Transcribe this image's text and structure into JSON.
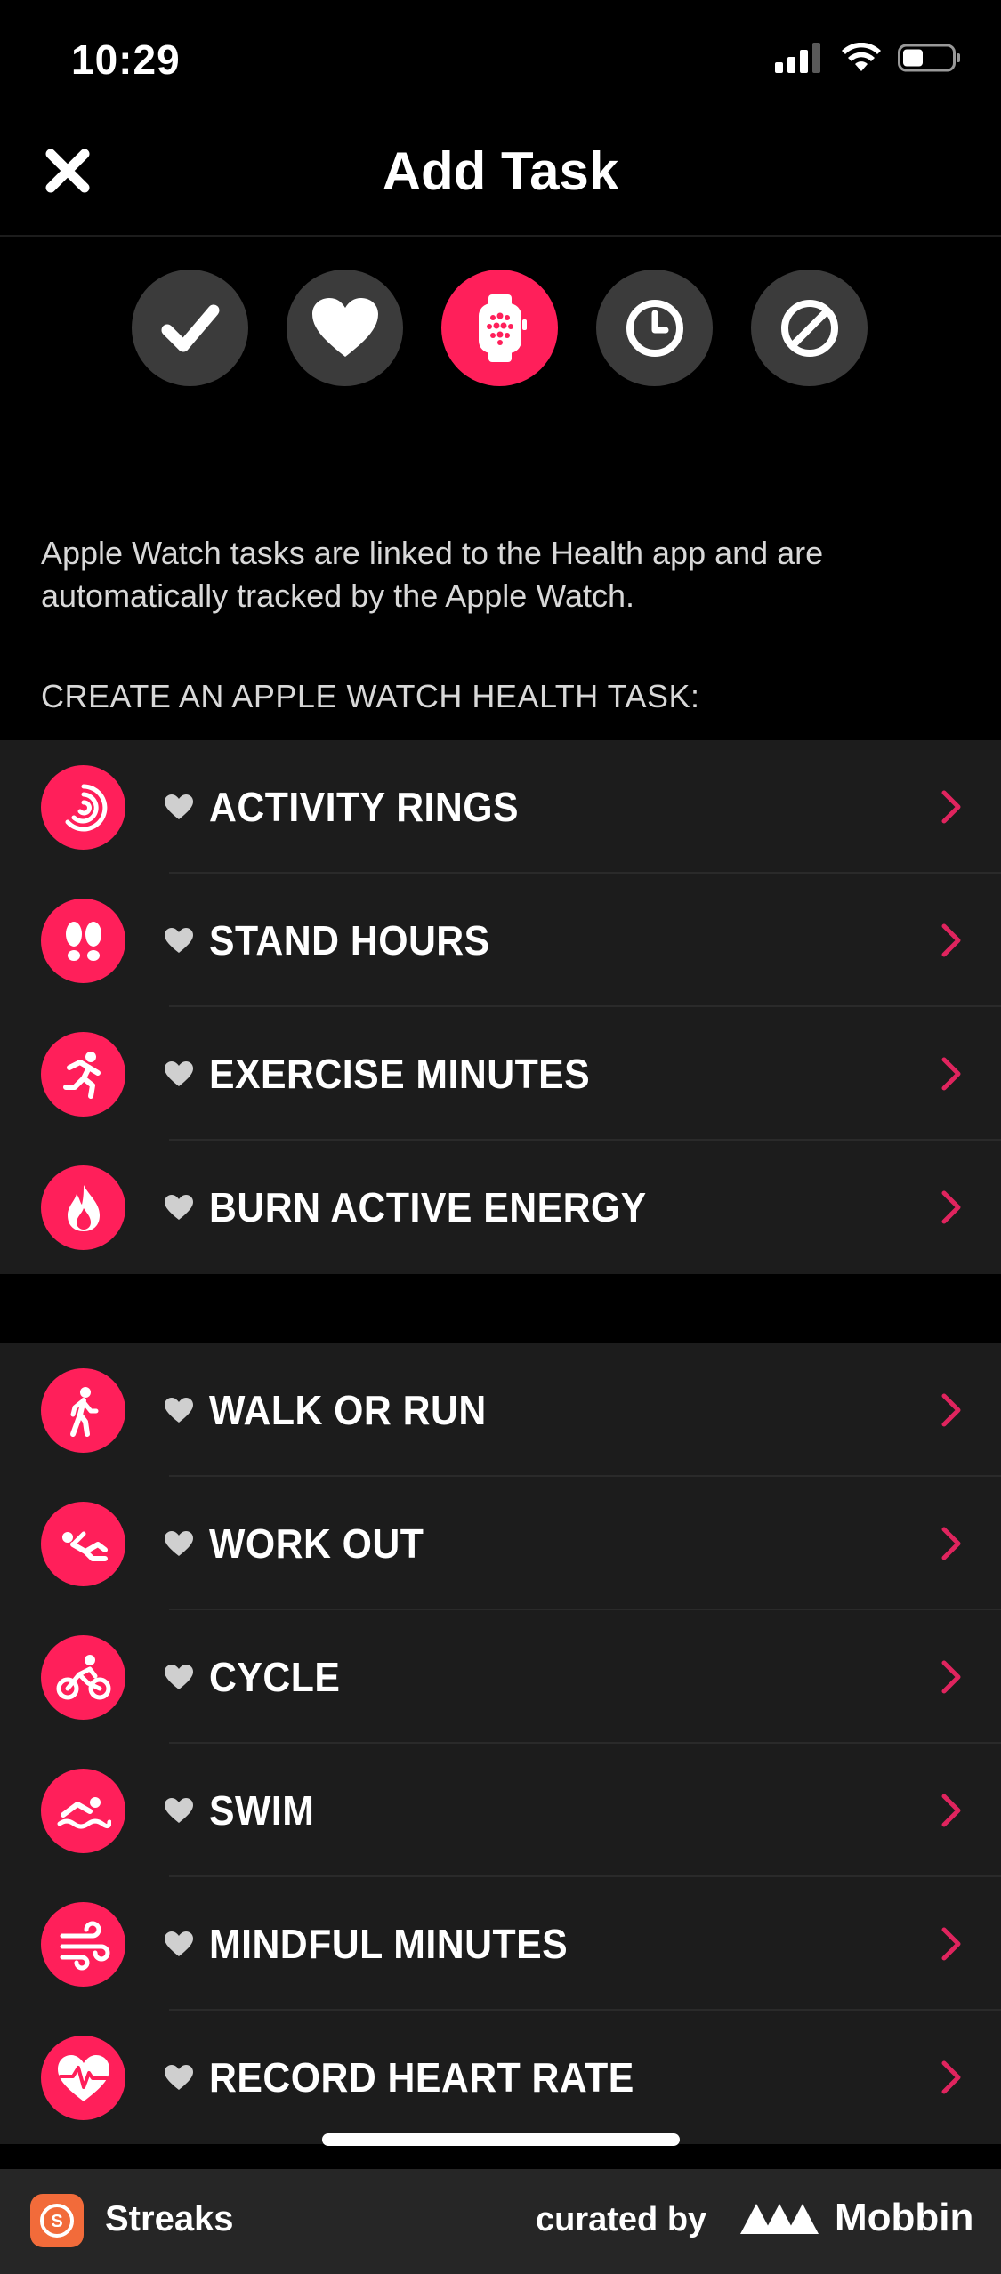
{
  "status": {
    "time": "10:29"
  },
  "nav": {
    "title": "Add Task"
  },
  "task_types": [
    {
      "icon": "checkmark-icon",
      "active": false
    },
    {
      "icon": "heart-icon",
      "active": false
    },
    {
      "icon": "apple-watch-icon",
      "active": true
    },
    {
      "icon": "clock-icon",
      "active": false
    },
    {
      "icon": "prohibited-icon",
      "active": false
    }
  ],
  "description": "Apple Watch tasks are linked to the Health app and are automatically tracked by the Apple Watch.",
  "section_label": "CREATE AN APPLE WATCH HEALTH TASK:",
  "groups": [
    {
      "items": [
        {
          "label": "ACTIVITY RINGS",
          "icon": "activity-rings-icon"
        },
        {
          "label": "STAND HOURS",
          "icon": "footprints-icon"
        },
        {
          "label": "EXERCISE MINUTES",
          "icon": "running-icon"
        },
        {
          "label": "BURN ACTIVE ENERGY",
          "icon": "flame-icon"
        }
      ]
    },
    {
      "items": [
        {
          "label": "WALK OR RUN",
          "icon": "walking-icon"
        },
        {
          "label": "WORK OUT",
          "icon": "workout-icon"
        },
        {
          "label": "CYCLE",
          "icon": "bicycle-icon"
        },
        {
          "label": "SWIM",
          "icon": "swimming-icon"
        },
        {
          "label": "MINDFUL MINUTES",
          "icon": "wind-icon"
        },
        {
          "label": "RECORD HEART RATE",
          "icon": "heart-rate-icon"
        }
      ]
    }
  ],
  "footer": {
    "app_name": "Streaks",
    "curated_by": "curated by",
    "brand": "Mobbin"
  },
  "colors": {
    "accent": "#ff1f5a",
    "background": "#000000",
    "row_bg": "#1c1c1c",
    "inactive_circle": "#3b3b3b"
  }
}
